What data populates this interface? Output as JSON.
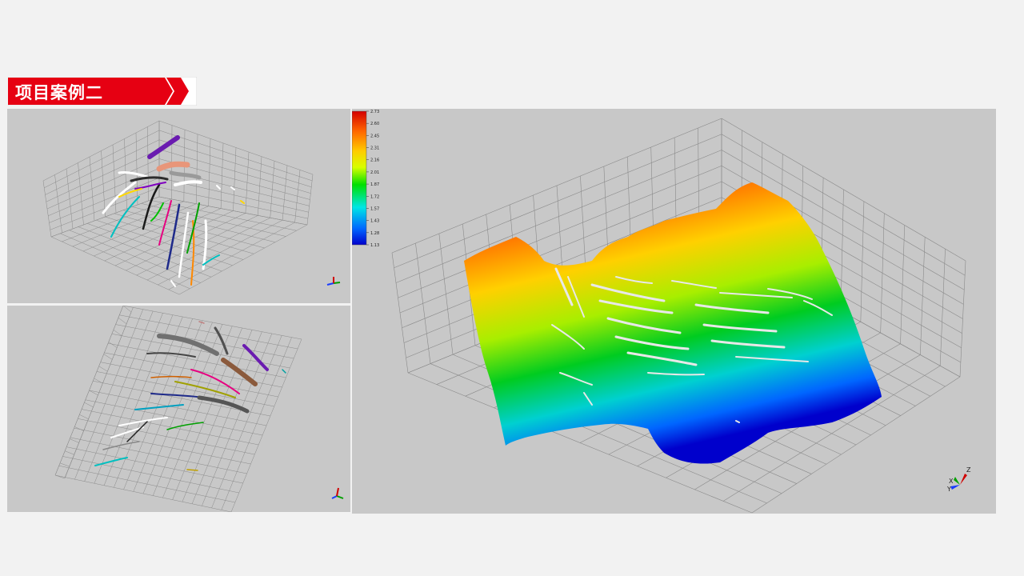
{
  "slide": {
    "title": "项目案例二",
    "accent_color": "#e60012",
    "background_color": "#f2f2f2"
  },
  "views": {
    "top": {
      "name": "fault-network-perspective"
    },
    "bottom": {
      "name": "fault-network-plan"
    },
    "main": {
      "name": "surface-3d",
      "colorbar": {
        "ticks": [
          "2.73",
          "2.60",
          "2.45",
          "2.31",
          "2.16",
          "2.01",
          "1.87",
          "1.72",
          "1.57",
          "1.43",
          "1.28",
          "1.13"
        ],
        "colors": [
          "#d40000",
          "#ff6600",
          "#ffcc00",
          "#d8ff00",
          "#00e000",
          "#00e6e6",
          "#0066ff",
          "#0000cc"
        ]
      }
    }
  },
  "axes_triad": {
    "x": "X",
    "y": "Y",
    "z": "Z"
  }
}
